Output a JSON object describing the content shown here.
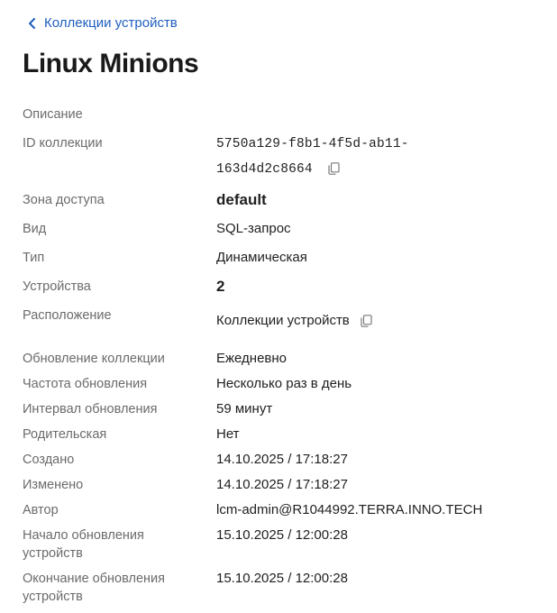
{
  "nav": {
    "back_label": "Коллекции устройств"
  },
  "page": {
    "title": "Linux Minions"
  },
  "fields": {
    "description": {
      "label": "Описание",
      "value": ""
    },
    "collection_id": {
      "label": "ID коллекции",
      "value_line1": "5750a129-f8b1-4f5d-ab11-",
      "value_line2": "163d4d2c8664"
    },
    "access_zone": {
      "label": "Зона доступа",
      "value": "default"
    },
    "kind": {
      "label": "Вид",
      "value": "SQL-запрос"
    },
    "type": {
      "label": "Тип",
      "value": "Динамическая"
    },
    "devices": {
      "label": "Устройства",
      "value": "2"
    },
    "location": {
      "label": "Расположение",
      "value": "Коллекции устройств"
    },
    "collection_update": {
      "label": "Обновление коллекции",
      "value": "Ежедневно"
    },
    "update_frequency": {
      "label": "Частота обновления",
      "value": "Несколько раз в день"
    },
    "update_interval": {
      "label": "Интервал обновления",
      "value": "59 минут"
    },
    "parent": {
      "label": "Родительская",
      "value": "Нет"
    },
    "created": {
      "label": "Создано",
      "value": "14.10.2025 / 17:18:27"
    },
    "modified": {
      "label": "Изменено",
      "value": "14.10.2025 / 17:18:27"
    },
    "author": {
      "label": "Автор",
      "value": "lcm-admin@R1044992.TERRA.INNO.TECH"
    },
    "device_update_start": {
      "label_line1": "Начало обновления",
      "label_line2": "устройств",
      "value": "15.10.2025 / 12:00:28"
    },
    "device_update_end": {
      "label_line1": "Окончание обновления",
      "label_line2": "устройств",
      "value": "15.10.2025 / 12:00:28"
    }
  },
  "icons": {
    "back": "chevron-left-icon",
    "copy": "copy-icon"
  },
  "colors": {
    "link": "#1f5fbf",
    "label": "#6b6b6b",
    "text": "#1f1f1f"
  }
}
